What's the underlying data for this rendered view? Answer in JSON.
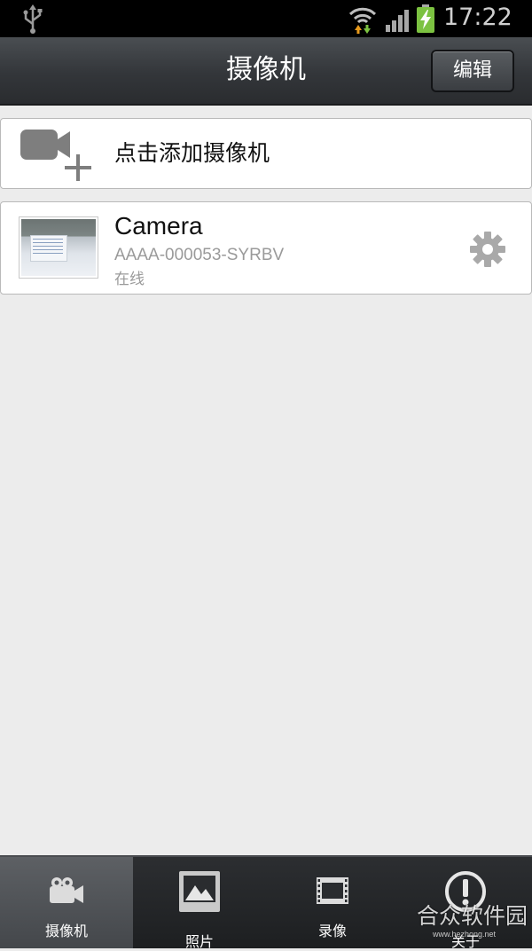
{
  "status_bar": {
    "time": "17:22",
    "icons": [
      "usb-icon",
      "wifi-icon",
      "signal-icon",
      "battery-charging-icon"
    ]
  },
  "action_bar": {
    "title": "摄像机",
    "edit_label": "编辑"
  },
  "add_camera": {
    "label": "点击添加摄像机",
    "icon": "video-camera-add-icon"
  },
  "cameras": [
    {
      "name": "Camera",
      "id": "AAAA-000053-SYRBV",
      "status": "在线",
      "settings_icon": "gear-icon"
    }
  ],
  "bottom_nav": {
    "items": [
      {
        "label": "摄像机",
        "icon": "camera-tab-icon",
        "active": true
      },
      {
        "label": "照片",
        "icon": "photo-icon",
        "active": false
      },
      {
        "label": "录像",
        "icon": "film-icon",
        "active": false
      },
      {
        "label": "关于",
        "icon": "info-icon",
        "active": false
      }
    ]
  },
  "watermark": {
    "text": "合众软件园",
    "url": "www.hezhong.net"
  },
  "colors": {
    "background": "#ececec",
    "action_bar": "#33363a",
    "nav_bar": "#1d1f21",
    "nav_active": "#505357",
    "secondary_text": "#9a9a9a"
  }
}
